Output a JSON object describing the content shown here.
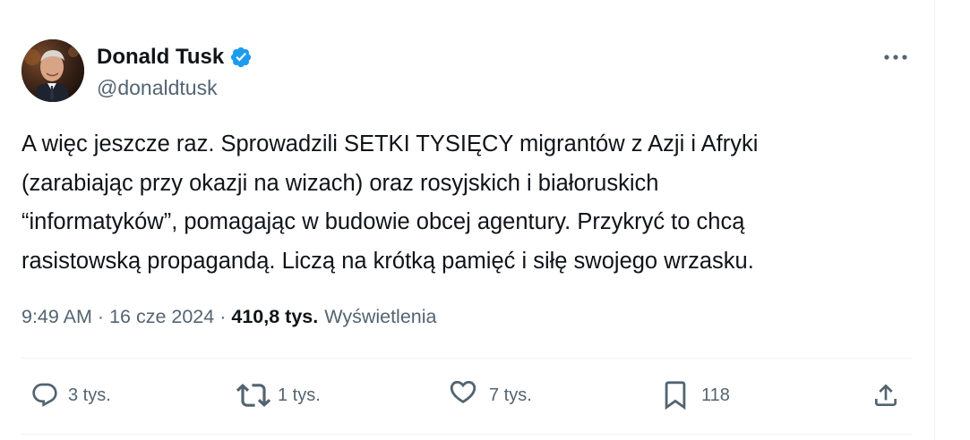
{
  "author": {
    "display_name": "Donald Tusk",
    "handle": "@donaldtusk",
    "verified_icon": "verified-badge-icon",
    "accent_color": "#1d9bf0"
  },
  "tweet": {
    "lines": [
      "A więc jeszcze raz. Sprowadzili SETKI TYSIĘCY migrantów z Azji i Afryki",
      "(zarabiając przy okazji na wizach) oraz rosyjskich i białoruskich",
      "“informatyków”, pomagając w budowie obcej agentury. Przykryć to chcą",
      "rasistowską propagandą. Liczą na krótką pamięć i siłę swojego wrzasku."
    ]
  },
  "meta": {
    "time": "9:49 AM",
    "separator": "·",
    "date": "16 cze 2024",
    "views_count": "410,8 tys.",
    "views_label": "Wyświetlenia"
  },
  "actions": {
    "reply": {
      "icon": "reply-icon",
      "count": "3 tys."
    },
    "retweet": {
      "icon": "retweet-icon",
      "count": "1 tys."
    },
    "like": {
      "icon": "heart-icon",
      "count": "7 tys."
    },
    "bookmark": {
      "icon": "bookmark-icon",
      "count": "118"
    },
    "share": {
      "icon": "share-icon"
    }
  },
  "colors": {
    "text_primary": "#0f1419",
    "text_secondary": "#536471",
    "border": "#eff3f4"
  }
}
